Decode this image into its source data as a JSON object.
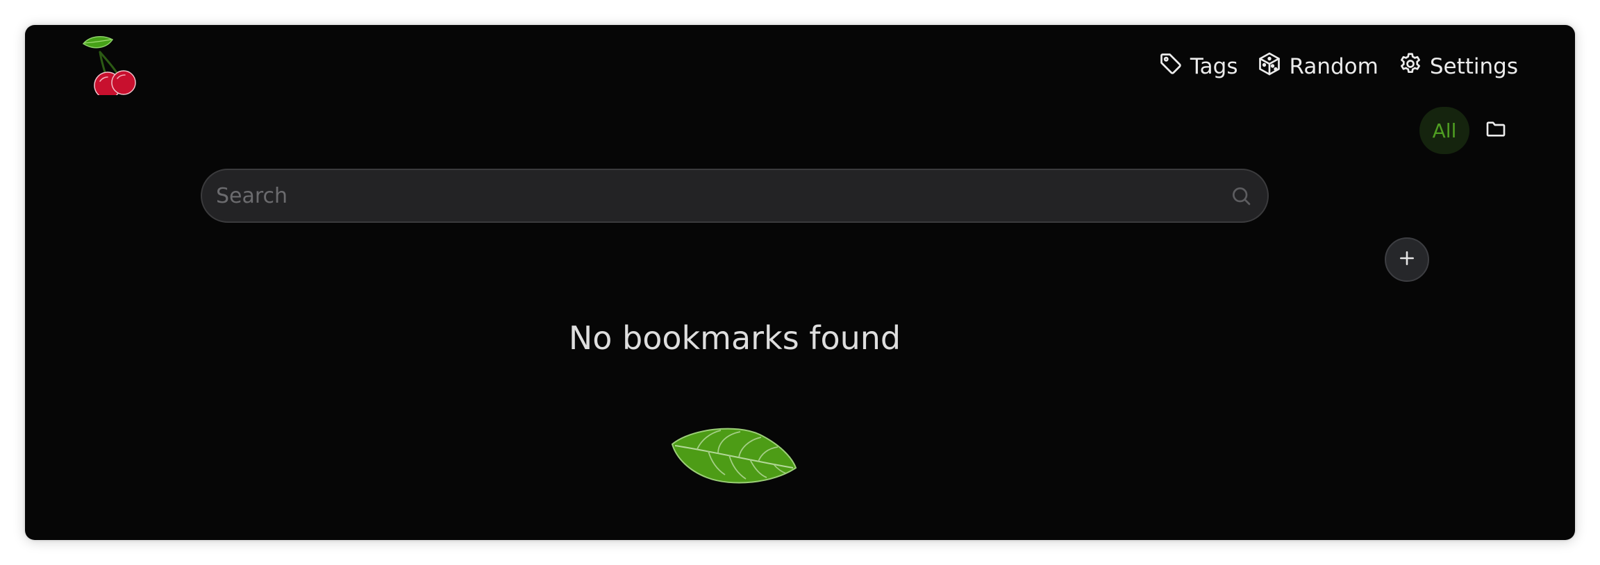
{
  "header": {
    "logo_icon": "cherry-logo-icon",
    "nav": [
      {
        "label": "Tags",
        "icon": "tag-icon"
      },
      {
        "label": "Random",
        "icon": "dice-cube-icon"
      },
      {
        "label": "Settings",
        "icon": "gear-icon"
      }
    ]
  },
  "filters": {
    "all_label": "All",
    "folder_icon": "folder-icon"
  },
  "search": {
    "placeholder": "Search",
    "value": "",
    "icon": "search-icon"
  },
  "actions": {
    "add_icon": "plus-icon"
  },
  "empty_state": {
    "message": "No bookmarks found",
    "illustration": "leaf-icon"
  },
  "colors": {
    "background": "#060606",
    "accent_green": "#4f9f22",
    "accent_green_bg": "#15240e",
    "search_bg": "#232325",
    "text": "#ececec",
    "cherry_red": "#c8102e"
  }
}
